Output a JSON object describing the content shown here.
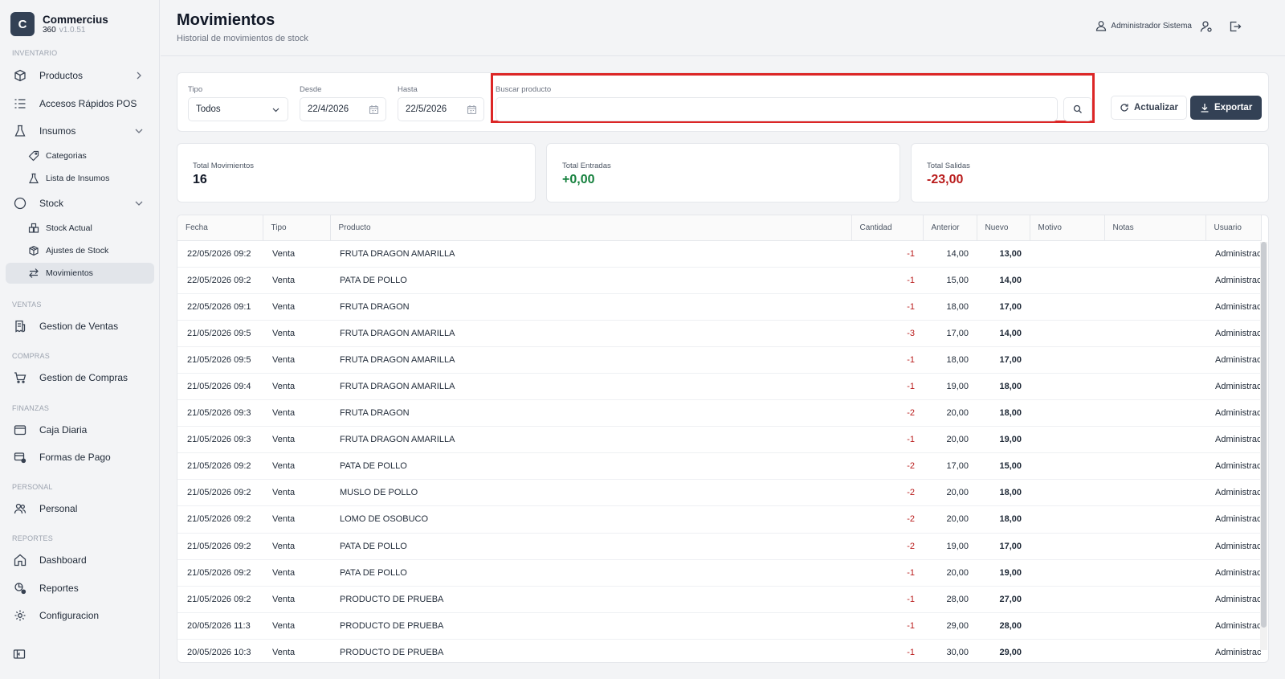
{
  "app": {
    "logo_letter": "C",
    "name": "Commercius",
    "sub": "360",
    "version": "v1.0.51"
  },
  "sidebar": {
    "sections": {
      "inventario": "INVENTARIO",
      "ventas": "VENTAS",
      "compras": "COMPRAS",
      "finanzas": "FINANZAS",
      "personal": "PERSONAL",
      "reportes": "REPORTES"
    },
    "items": {
      "productos": "Productos",
      "accesos": "Accesos Rápidos POS",
      "insumos": "Insumos",
      "categorias": "Categorias",
      "lista_insumos": "Lista de Insumos",
      "stock": "Stock",
      "stock_actual": "Stock Actual",
      "ajustes": "Ajustes de Stock",
      "movimientos": "Movimientos",
      "gestion_ventas": "Gestion de Ventas",
      "gestion_compras": "Gestion de Compras",
      "caja_diaria": "Caja Diaria",
      "formas_pago": "Formas de Pago",
      "personal": "Personal",
      "dashboard": "Dashboard",
      "reportes": "Reportes",
      "configuracion": "Configuracion"
    }
  },
  "header": {
    "title": "Movimientos",
    "subtitle": "Historial de movimientos de stock",
    "user": "Administrador Sistema"
  },
  "filters": {
    "tipo_label": "Tipo",
    "tipo_value": "Todos",
    "desde_label": "Desde",
    "desde_value": "22/4/2026",
    "hasta_label": "Hasta",
    "hasta_value": "22/5/2026",
    "search_label": "Buscar producto",
    "search_value": "",
    "refresh_label": "Actualizar",
    "export_label": "Exportar"
  },
  "stats": {
    "total_movimientos_label": "Total Movimientos",
    "total_movimientos": "16",
    "total_entradas_label": "Total Entradas",
    "total_entradas": "+0,00",
    "total_salidas_label": "Total Salidas",
    "total_salidas": "-23,00",
    "colors": {
      "entradas": "#15803d",
      "salidas": "#b91c1c"
    }
  },
  "table": {
    "columns": [
      "Fecha",
      "Tipo",
      "Producto",
      "Cantidad",
      "Anterior",
      "Nuevo",
      "Motivo",
      "Notas",
      "Usuario"
    ],
    "rows": [
      [
        "22/05/2026 09:2",
        "Venta",
        "FRUTA DRAGON AMARILLA",
        "-1",
        "14,00",
        "13,00",
        "",
        "",
        "Administrac"
      ],
      [
        "22/05/2026 09:2",
        "Venta",
        "PATA DE POLLO",
        "-1",
        "15,00",
        "14,00",
        "",
        "",
        "Administrac"
      ],
      [
        "22/05/2026 09:1",
        "Venta",
        "FRUTA DRAGON",
        "-1",
        "18,00",
        "17,00",
        "",
        "",
        "Administrac"
      ],
      [
        "21/05/2026 09:5",
        "Venta",
        "FRUTA DRAGON AMARILLA",
        "-3",
        "17,00",
        "14,00",
        "",
        "",
        "Administrac"
      ],
      [
        "21/05/2026 09:5",
        "Venta",
        "FRUTA DRAGON AMARILLA",
        "-1",
        "18,00",
        "17,00",
        "",
        "",
        "Administrac"
      ],
      [
        "21/05/2026 09:4",
        "Venta",
        "FRUTA DRAGON AMARILLA",
        "-1",
        "19,00",
        "18,00",
        "",
        "",
        "Administrac"
      ],
      [
        "21/05/2026 09:3",
        "Venta",
        "FRUTA DRAGON",
        "-2",
        "20,00",
        "18,00",
        "",
        "",
        "Administrac"
      ],
      [
        "21/05/2026 09:3",
        "Venta",
        "FRUTA DRAGON AMARILLA",
        "-1",
        "20,00",
        "19,00",
        "",
        "",
        "Administrac"
      ],
      [
        "21/05/2026 09:2",
        "Venta",
        "PATA DE POLLO",
        "-2",
        "17,00",
        "15,00",
        "",
        "",
        "Administrac"
      ],
      [
        "21/05/2026 09:2",
        "Venta",
        "MUSLO DE POLLO",
        "-2",
        "20,00",
        "18,00",
        "",
        "",
        "Administrac"
      ],
      [
        "21/05/2026 09:2",
        "Venta",
        "LOMO DE OSOBUCO",
        "-2",
        "20,00",
        "18,00",
        "",
        "",
        "Administrac"
      ],
      [
        "21/05/2026 09:2",
        "Venta",
        "PATA DE POLLO",
        "-2",
        "19,00",
        "17,00",
        "",
        "",
        "Administrac"
      ],
      [
        "21/05/2026 09:2",
        "Venta",
        "PATA DE POLLO",
        "-1",
        "20,00",
        "19,00",
        "",
        "",
        "Administrac"
      ],
      [
        "21/05/2026 09:2",
        "Venta",
        "PRODUCTO DE PRUEBA",
        "-1",
        "28,00",
        "27,00",
        "",
        "",
        "Administrac"
      ],
      [
        "20/05/2026 11:3",
        "Venta",
        "PRODUCTO DE PRUEBA",
        "-1",
        "29,00",
        "28,00",
        "",
        "",
        "Administrac"
      ],
      [
        "20/05/2026 10:3",
        "Venta",
        "PRODUCTO DE PRUEBA",
        "-1",
        "30,00",
        "29,00",
        "",
        "",
        "Administrac"
      ]
    ]
  }
}
